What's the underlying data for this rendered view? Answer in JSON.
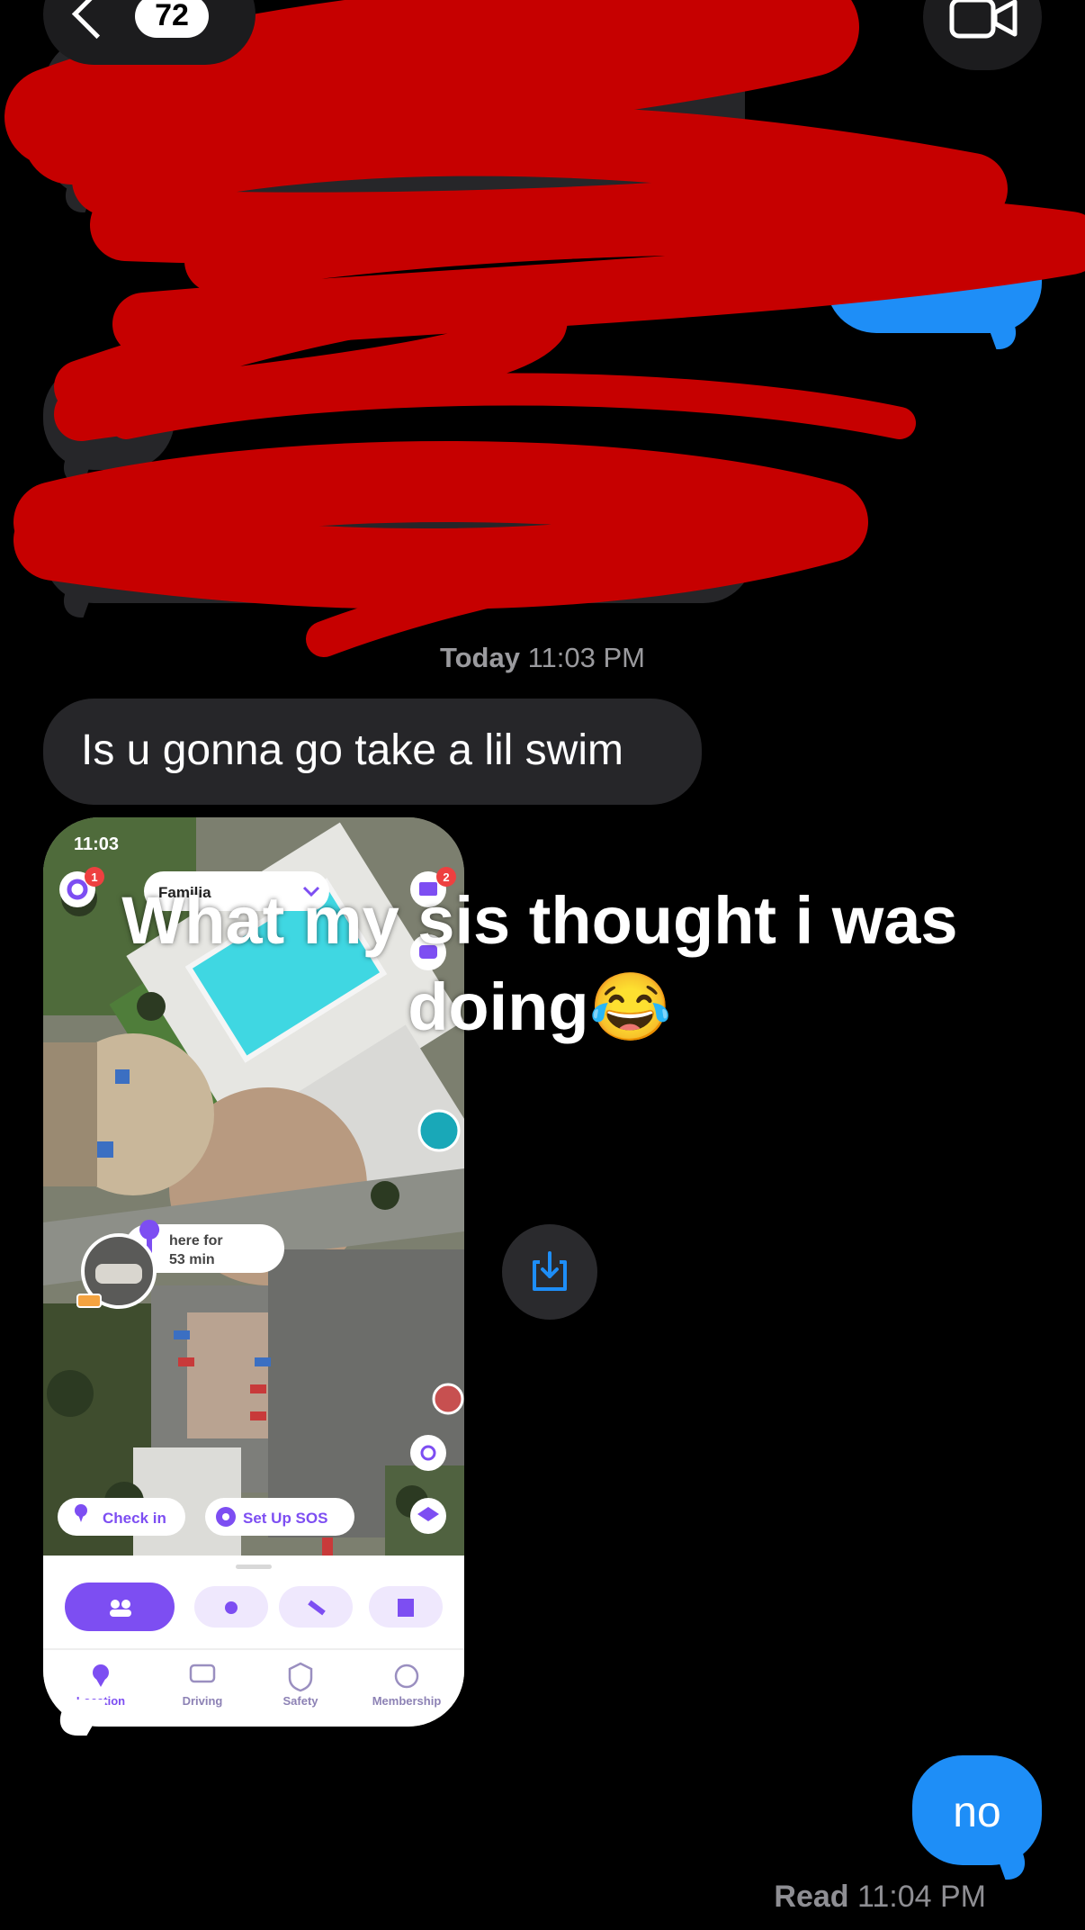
{
  "nav": {
    "back_count": "72"
  },
  "messages": {
    "timestamp_day": "Today",
    "timestamp_time": "11:03 PM",
    "received_text": "Is u gonna go take a lil swim",
    "overlay_caption": "What my sis thought i was doing😂",
    "sent_text": "no",
    "read_label": "Read",
    "read_time": "11:04 PM"
  },
  "screenshot": {
    "status_time": "11:03",
    "circle_name": "Familia",
    "settings_badge": "1",
    "mail_badge": "2",
    "here_for_label": "here for",
    "here_for_duration": "53 min",
    "check_in_label": "Check in",
    "sos_label": "Set Up SOS",
    "nav_tabs": [
      "Location",
      "Driving",
      "Safety",
      "Membership"
    ]
  },
  "colors": {
    "bubble_received": "#262629",
    "bubble_sent": "#1e8ef7",
    "scribble": "#c60000",
    "app_purple": "#7d4ef2"
  }
}
